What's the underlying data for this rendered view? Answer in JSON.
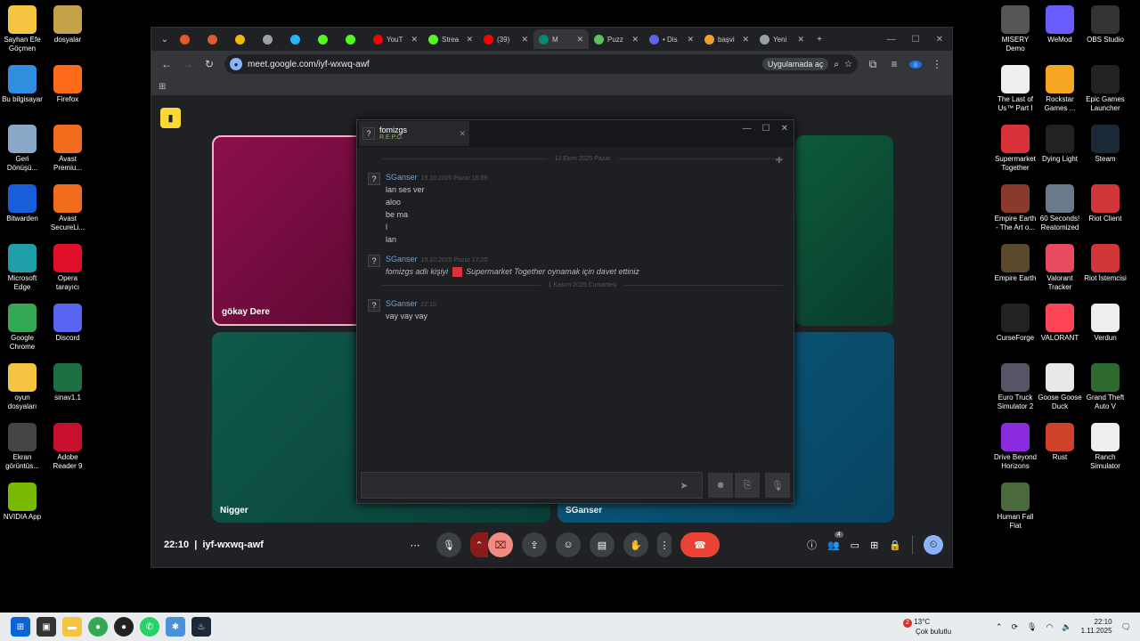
{
  "desktop_left": [
    {
      "label": "Sayhan Efe Göçmen",
      "icon": "folder-icon",
      "color": "#f5c542"
    },
    {
      "label": "dosyalar",
      "icon": "folder-icon",
      "color": "#c5a24a"
    },
    {
      "label": "Bu bilgisayar",
      "icon": "computer-icon",
      "color": "#2f8ee0"
    },
    {
      "label": "Firefox",
      "icon": "firefox-icon",
      "color": "#ff6a1a"
    },
    {
      "label": "Geri Dönüşü...",
      "icon": "recycle-bin-icon",
      "color": "#8aa8c8"
    },
    {
      "label": "Avast Premiu...",
      "icon": "avast-icon",
      "color": "#f26c1d"
    },
    {
      "label": "Bitwarden",
      "icon": "bitwarden-icon",
      "color": "#175ddc"
    },
    {
      "label": "Avast SecureLi...",
      "icon": "avast-secureline-icon",
      "color": "#f26c1d"
    },
    {
      "label": "Microsoft Edge",
      "icon": "edge-icon",
      "color": "#1fa0a8"
    },
    {
      "label": "Opera tarayıcı",
      "icon": "opera-icon",
      "color": "#e0102a"
    },
    {
      "label": "Google Chrome",
      "icon": "chrome-icon",
      "color": "#34a853"
    },
    {
      "label": "Discord",
      "icon": "discord-icon",
      "color": "#5865f2"
    },
    {
      "label": "oyun dosyaları",
      "icon": "folder-icon",
      "color": "#f5c542"
    },
    {
      "label": "sinav1.1",
      "icon": "excel-icon",
      "color": "#1d7044"
    },
    {
      "label": "Ekran görüntüs...",
      "icon": "screenshot-folder-icon",
      "color": "#444"
    },
    {
      "label": "Adobe Reader 9",
      "icon": "adobe-reader-icon",
      "color": "#c8102e"
    },
    {
      "label": "NVIDIA App",
      "icon": "nvidia-icon",
      "color": "#76b900"
    }
  ],
  "desktop_right": [
    {
      "label": "MISERY Demo",
      "icon": "misery-icon",
      "color": "#555"
    },
    {
      "label": "WeMod",
      "icon": "wemod-icon",
      "color": "#6a5cff"
    },
    {
      "label": "OBS Studio",
      "icon": "obs-icon",
      "color": "#333"
    },
    {
      "label": "The Last of Us™ Part I",
      "icon": "document-icon",
      "color": "#eee"
    },
    {
      "label": "Rockstar Games ...",
      "icon": "rockstar-icon",
      "color": "#f5a623"
    },
    {
      "label": "Epic Games Launcher",
      "icon": "epic-icon",
      "color": "#222"
    },
    {
      "label": "Supermarket Together",
      "icon": "supermarket-icon",
      "color": "#d9323b"
    },
    {
      "label": "Dying Light",
      "icon": "dying-light-icon",
      "color": "#222"
    },
    {
      "label": "Steam",
      "icon": "steam-icon",
      "color": "#1b2838"
    },
    {
      "label": "Empire Earth - The Art o...",
      "icon": "empire-earth-icon",
      "color": "#8a3a2a"
    },
    {
      "label": "60 Seconds! Reatomized",
      "icon": "sixty-seconds-icon",
      "color": "#6b7a8a"
    },
    {
      "label": "Riot Client",
      "icon": "riot-icon",
      "color": "#d13639"
    },
    {
      "label": "Empire Earth",
      "icon": "empire-earth-icon",
      "color": "#5a4a2a"
    },
    {
      "label": "Valorant Tracker",
      "icon": "valorant-tracker-icon",
      "color": "#e84a5f"
    },
    {
      "label": "Riot İstemcisi",
      "icon": "riot-icon",
      "color": "#d13639"
    },
    {
      "label": "CurseForge",
      "icon": "curseforge-icon",
      "color": "#222"
    },
    {
      "label": "VALORANT",
      "icon": "valorant-icon",
      "color": "#fd4556"
    },
    {
      "label": "Verdun",
      "icon": "verdun-icon",
      "color": "#eee"
    },
    {
      "label": "Euro Truck Simulator 2",
      "icon": "ets2-icon",
      "color": "#556"
    },
    {
      "label": "Goose Goose Duck",
      "icon": "goose-icon",
      "color": "#e8e8e8"
    },
    {
      "label": "Grand Theft Auto V",
      "icon": "gta-icon",
      "color": "#2e6a2e"
    },
    {
      "label": "Drive Beyond Horizons",
      "icon": "drive-beyond-icon",
      "color": "#8a2be2"
    },
    {
      "label": "Rust",
      "icon": "rust-icon",
      "color": "#ce422b"
    },
    {
      "label": "Ranch Simulator",
      "icon": "ranch-icon",
      "color": "#eee"
    },
    {
      "label": "Human Fall Flat",
      "icon": "human-fall-flat-icon",
      "color": "#4a6a3a"
    }
  ],
  "browser": {
    "tabs": [
      {
        "label": "",
        "icon": "opera-tab-icon",
        "color": "#e05a2b"
      },
      {
        "label": "",
        "icon": "opera-tab-icon",
        "color": "#e05a2b"
      },
      {
        "label": "",
        "icon": "crypto-tab-icon",
        "color": "#f0b90b"
      },
      {
        "label": "",
        "icon": "globe-tab-icon",
        "color": "#9aa0a6"
      },
      {
        "label": "",
        "icon": "cloud-tab-icon",
        "color": "#29b6f6"
      },
      {
        "label": "",
        "icon": "kick-tab-icon",
        "color": "#53fc18"
      },
      {
        "label": "",
        "icon": "kick-tab-icon",
        "color": "#53fc18"
      },
      {
        "label": "YouT",
        "icon": "youtube-tab-icon",
        "color": "#ff0000"
      },
      {
        "label": "Strea",
        "icon": "kick-tab-icon",
        "color": "#53fc18"
      },
      {
        "label": "(39)",
        "icon": "youtube-tab-icon",
        "color": "#ff0000"
      },
      {
        "label": "M",
        "icon": "meet-tab-icon",
        "color": "#00897b",
        "active": true
      },
      {
        "label": "Puzz",
        "icon": "puzzle-tab-icon",
        "color": "#5bbf5b"
      },
      {
        "label": "• Dis",
        "icon": "discord-tab-icon",
        "color": "#5865f2"
      },
      {
        "label": "başvi",
        "icon": "doc-tab-icon",
        "color": "#f0a030"
      },
      {
        "label": "Yeni",
        "icon": "chrome-tab-icon",
        "color": "#9aa0a6"
      }
    ],
    "url": "meet.google.com/iyf-wxwq-awf",
    "open_in_app": "Uygulamada aç"
  },
  "meet": {
    "participants": [
      {
        "name": "gökay Dere"
      },
      {
        "name": "Nigger"
      },
      {
        "name": "SGanser"
      }
    ],
    "time": "22:10",
    "meeting_code": "iyf-wxwq-awf",
    "people_count": "4"
  },
  "chat": {
    "friend_name": "fomizgs",
    "friend_game": "R.E.P.O.",
    "date_divider_1": "13 Ekim 2025 Pazar",
    "date_divider_2": "1 Kasım 2025 Cumartesi",
    "messages": [
      {
        "author": "SGanser",
        "time": "19.10.2025 Pazar 16:59",
        "lines": [
          "lan ses ver",
          "aloo",
          "be ma",
          "l",
          "lan"
        ]
      },
      {
        "author": "SGanser",
        "time": "19.10.2025 Pazar 17:20",
        "invite_prefix": "fomizgs adlı kişiyi",
        "invite_game": "Supermarket Together oynamak için davet ettiniz"
      },
      {
        "author": "SGanser",
        "time": "22:10",
        "lines": [
          "vay vay vay"
        ]
      }
    ]
  },
  "taskbar": {
    "weather_temp": "13°C",
    "weather_desc": "Çok bulutlu",
    "weather_badge": "2",
    "clock_time": "22:10",
    "clock_date": "1.11.2025"
  }
}
